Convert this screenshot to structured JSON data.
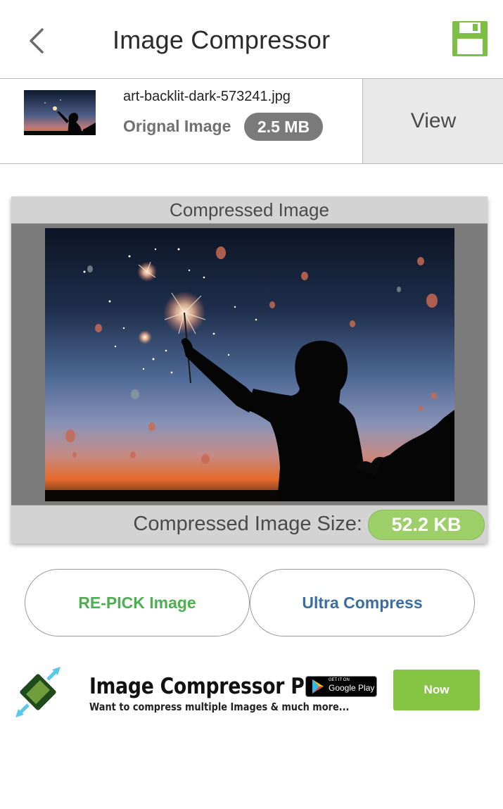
{
  "header": {
    "title": "Image Compressor",
    "back_icon": "chevron-left-icon",
    "save_icon": "floppy-disk-icon",
    "save_color": "#7cc043"
  },
  "original": {
    "filename": "art-backlit-dark-573241.jpg",
    "label": "Orignal Image",
    "size": "2.5 MB",
    "view_label": "View"
  },
  "compressed": {
    "heading": "Compressed Image",
    "size_label": "Compressed Image Size:",
    "size": "52.2 KB"
  },
  "actions": {
    "repick_label": "RE-PICK Image",
    "ultra_label": "Ultra Compress"
  },
  "ad": {
    "title": "Image Compressor Pro",
    "subtitle": "Want to compress multiple Images & much more...",
    "store_small": "GET IT ON",
    "store_name": "Google Play",
    "cta": "Now"
  }
}
